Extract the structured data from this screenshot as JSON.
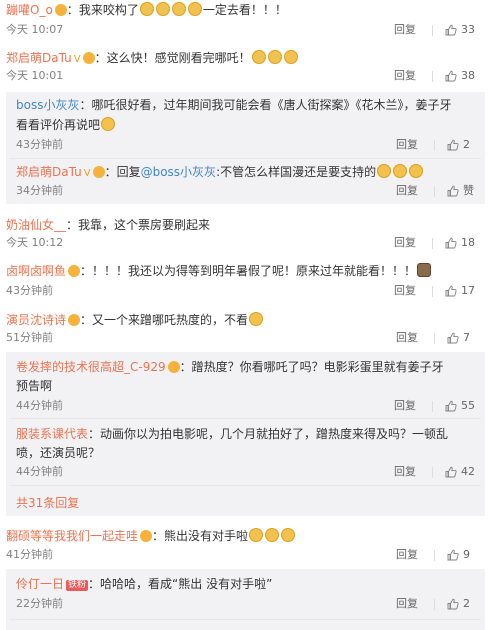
{
  "comments": [
    {
      "name": "蹦嚾O_o",
      "text": "我来咬构了",
      "text2": "一定去看！！！",
      "time": "今天 10:07",
      "reply": "回复",
      "likes": "33"
    },
    {
      "name": "郑启萌DaTu",
      "text": "这么快！感觉刚看完哪吒！",
      "time": "今天 10:01",
      "reply": "回复",
      "likes": "38"
    },
    {
      "name": "奶油仙女__",
      "text": "我靠，这个票房要刷起来",
      "time": "今天 10:12",
      "reply": "回复",
      "likes": "18"
    },
    {
      "name": "卤啊卤啊鱼",
      "text": "！！！我还以为得等到明年暑假了呢！原来过年就能看！！！",
      "time": "43分钟前",
      "reply": "回复",
      "likes": "17"
    },
    {
      "name": "演员沈诗诗",
      "text": "又一个来蹭哪吒热度的，不看",
      "time": "51分钟前",
      "reply": "回复",
      "likes": "7"
    },
    {
      "name": "翻硕等等我我们一起走哇",
      "text": "熊出没有对手啦",
      "time": "41分钟前",
      "reply": "回复",
      "likes": "9"
    }
  ],
  "replies": [
    {
      "name": "boss小灰灰",
      "text": "哪吒很好看，过年期间我可能会看《唐人街探案》《花木兰》，姜子牙",
      "text2": "看看评价再说吧",
      "time": "43分钟前",
      "reply": "回复",
      "likes": "2"
    },
    {
      "name": "郑启萌DaTu",
      "prefix": "回复",
      "mention": "@boss小灰灰",
      "text": ":不管怎么样国漫还是要支持的",
      "time": "34分钟前",
      "reply": "回复",
      "likes": "赞"
    },
    {
      "name": "卷发摔的技术很高超_C-929",
      "text": "蹭热度？你看哪吒了吗？电影彩蛋里就有姜子牙",
      "text2": "预告啊",
      "time": "44分钟前",
      "reply": "回复",
      "likes": "55"
    },
    {
      "name": "服装系课代表",
      "text": "动画你以为拍电影呢，几个月就拍好了，蹭热度来得及吗？一顿乱",
      "text2": "喷，还演员呢？",
      "time": "44分钟前",
      "reply": "回复",
      "likes": "42"
    },
    {
      "name": "伶仃一日",
      "badge": "铁粉",
      "text": "哈哈哈，看成“熊出 没有对手啦”",
      "time": "22分钟前",
      "reply": "回复",
      "likes": "2"
    }
  ],
  "more_replies": "共31条回复"
}
